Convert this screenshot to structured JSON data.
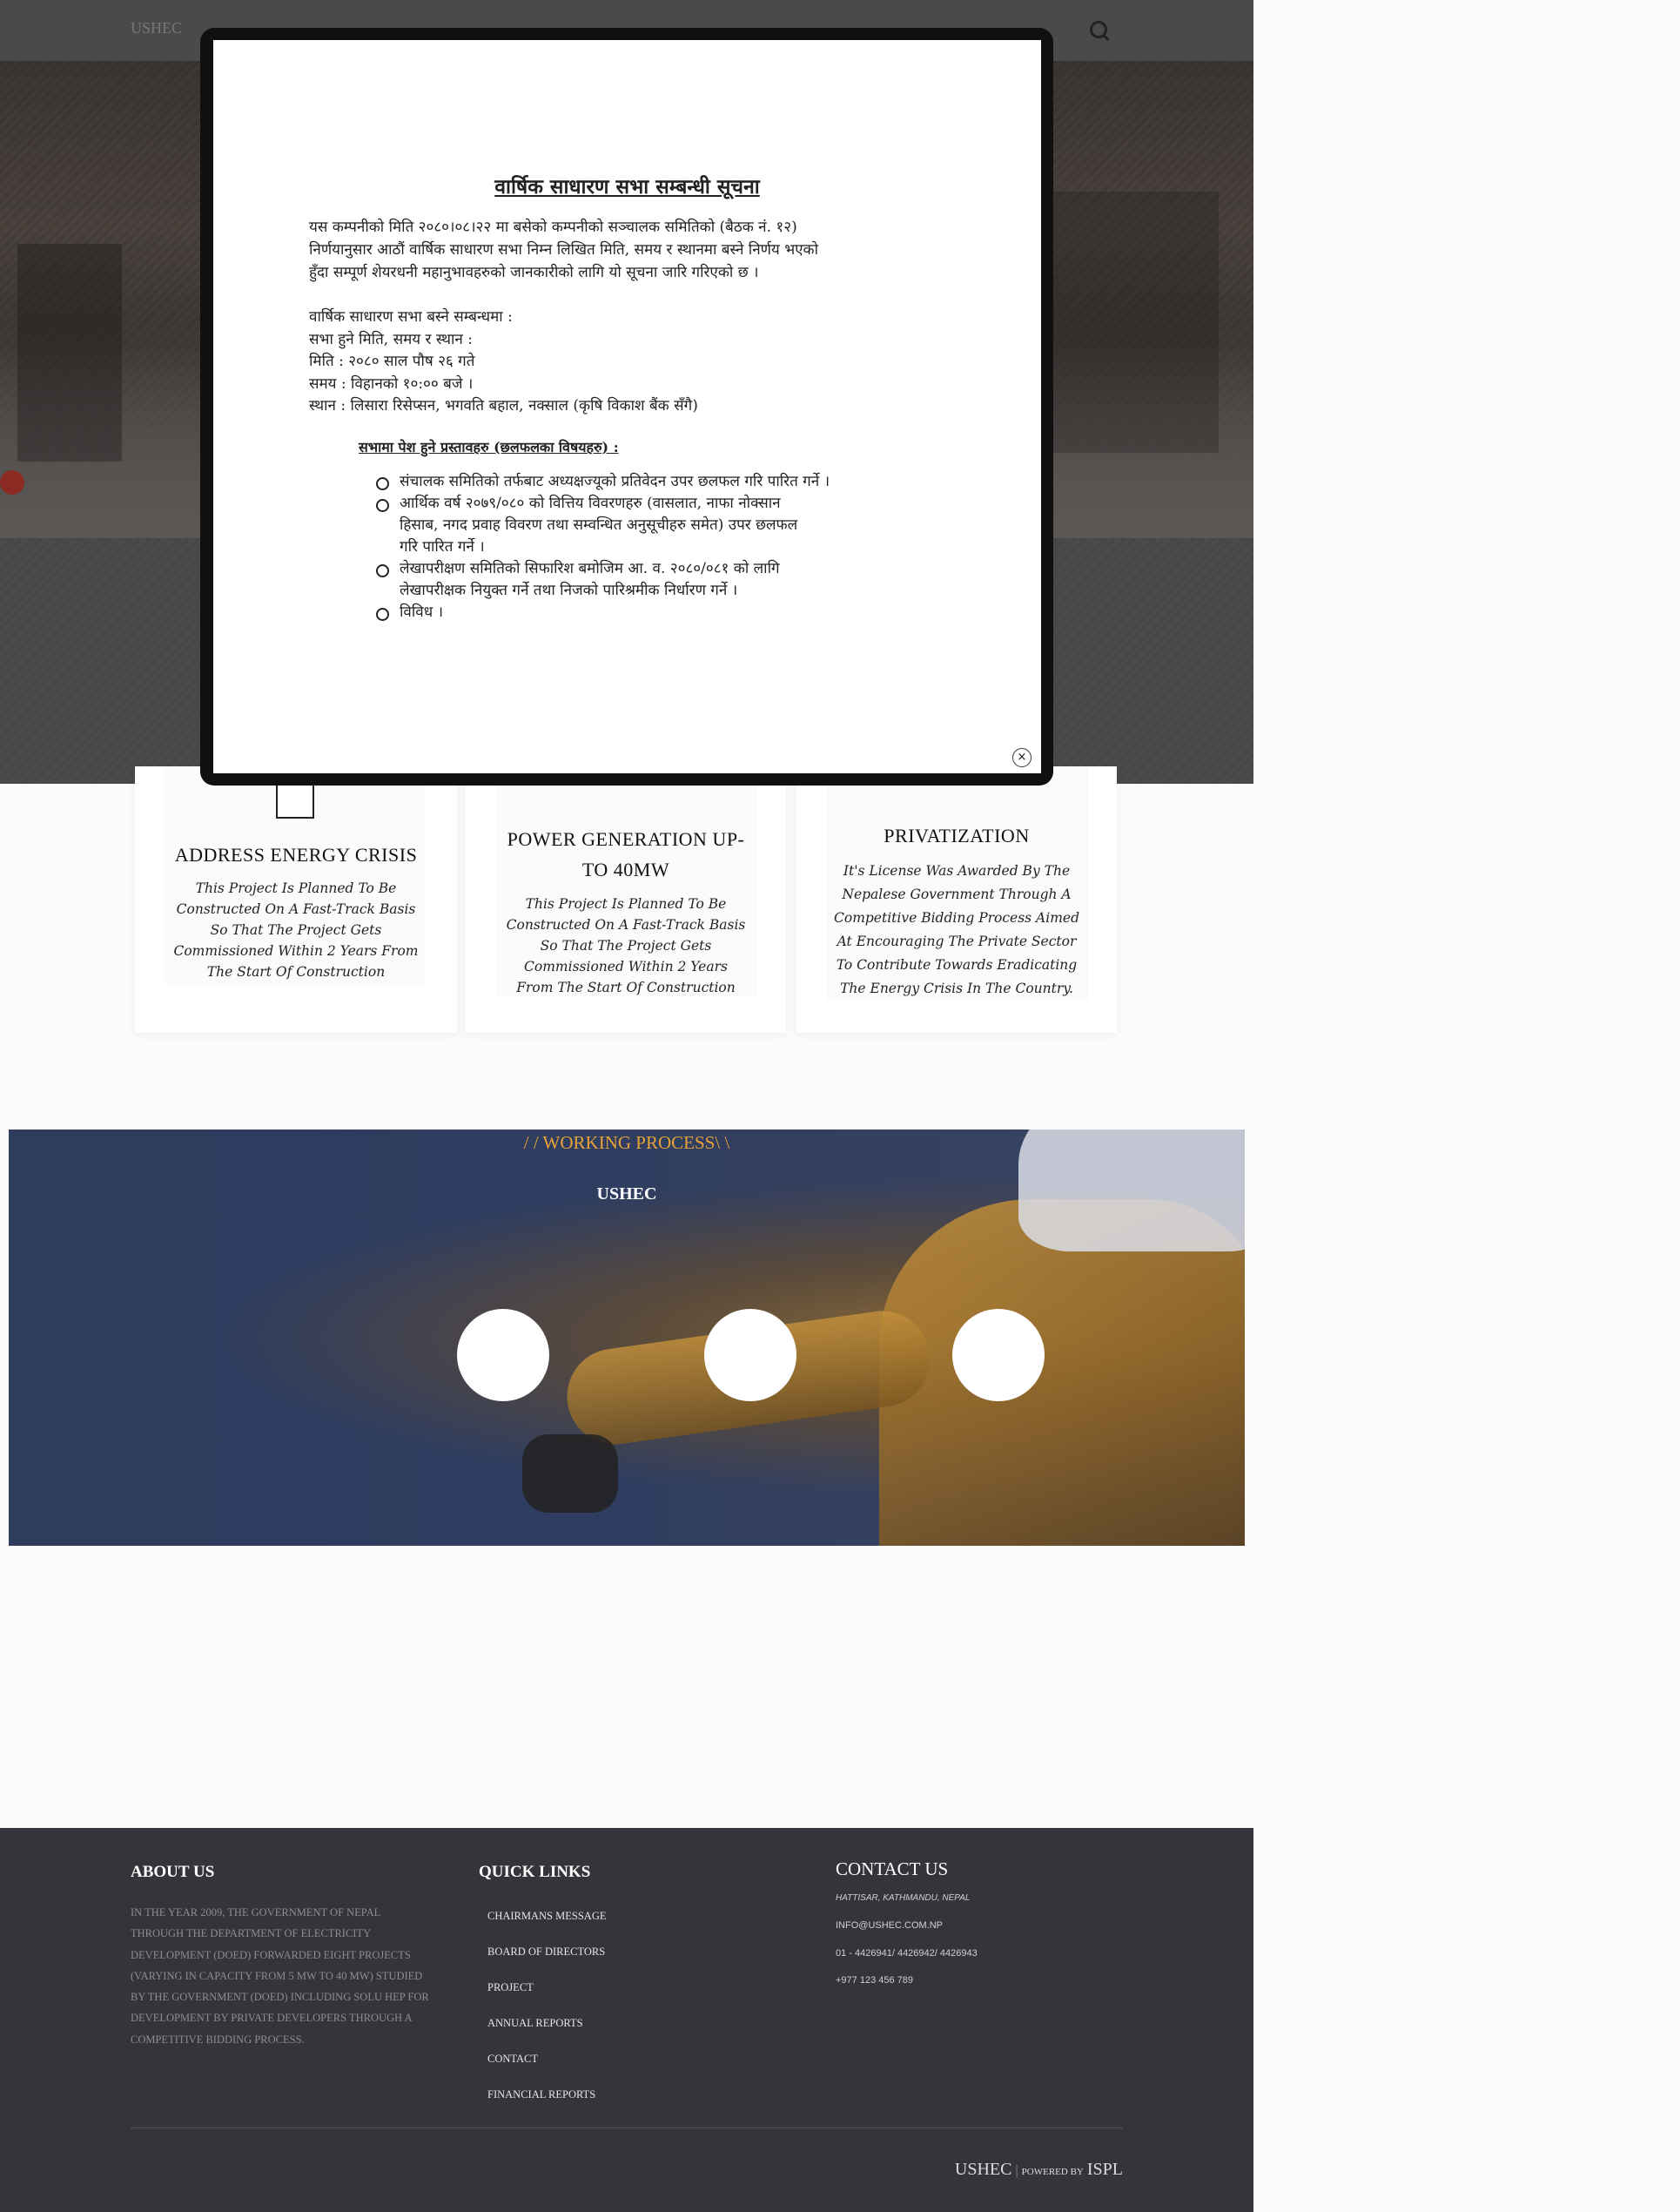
{
  "header": {
    "brand": "USHEC"
  },
  "features": [
    {
      "title": "ADDRESS ENERGY CRISIS",
      "text": "This Project Is Planned To Be Constructed On A Fast-Track Basis So That The Project Gets Commissioned Within 2 Years From The Start Of Construction"
    },
    {
      "title": "POWER GENERATION UP-TO 40MW",
      "text": "This Project Is Planned To Be Constructed On A Fast-Track Basis So That The Project Gets Commissioned Within 2 Years From The Start Of Construction"
    },
    {
      "title": "PRIVATIZATION",
      "text": "It's License Was Awarded By The Nepalese Government Through A Competitive Bidding Process Aimed At Encouraging The Private Sector To Contribute Towards Eradicating The Energy Crisis In The Country."
    }
  ],
  "process": {
    "title": "/ / WORKING PROCESS\\ \\",
    "subtitle": "USHEC"
  },
  "footer": {
    "about_heading": "ABOUT US",
    "about_text": "IN THE YEAR 2009,  THE GOVERNMENT OF NEPAL THROUGH THE DEPARTMENT OF ELECTRICITY DEVELOPMENT (DOED) FORWARDED EIGHT PROJECTS (VARYING IN CAPACITY FROM 5 MW TO 40 MW) STUDIED BY THE GOVERNMENT (DOED) INCLUDING SOLU HEP FOR DEVELOPMENT BY PRIVATE DEVELOPERS THROUGH A COMPETITIVE BIDDING PROCESS.",
    "links_heading": "QUICK LINKS",
    "links": [
      "CHAIRMANS MESSAGE",
      "BOARD OF DIRECTORS",
      "PROJECT",
      "ANNUAL REPORTS",
      "CONTACT",
      "FINANCIAL REPORTS"
    ],
    "contact_heading": "CONTACT US",
    "address": "HATTISAR, KATHMANDU, NEPAL",
    "email": "INFO@USHEC.COM.NP",
    "phone": "01 - 4426941/ 4426942/ 4426943",
    "mobile": "+977 123 456 789",
    "copyright_brand": "USHEC",
    "powered_by": "POWERED BY",
    "powered_brand": "ISPL"
  },
  "modal": {
    "notice_title": "वार्षिक साधारण सभा सम्बन्धी सूचना",
    "intro_lines": [
      "यस कम्पनीको मिति २०८०।०८।२२ मा बसेको कम्पनीको सञ्चालक समितिको (बैठक नं. १२)",
      "निर्णयानुसार आठौं वार्षिक साधारण सभा निम्न लिखित मिति, समय र स्थानमा बस्ने निर्णय भएको",
      "हुँदा सम्पूर्ण शेयरधनी महानुभावहरुको जानकारीको लागि यो सूचना जारि गरिएको छ ।"
    ],
    "meeting_lines": [
      "वार्षिक साधारण सभा बस्ने सम्बन्धमा :",
      "सभा हुने मिति, समय र स्थान :",
      "मिति : २०८० साल पौष २६ गते",
      "समय : विहानको १०:०० बजे ।",
      "स्थान : लिसारा रिसेप्सन, भगवति बहाल, नक्साल (कृषि विकाश बैंक सँगै)"
    ],
    "agenda_heading": "सभामा पेश हुने प्रस्तावहरु (छलफलका विषयहरु) :",
    "agenda": [
      [
        "संचालक समितिको तर्फबाट अध्यक्षज्यूको प्रतिवेदन उपर छलफल गरि पारित गर्ने ।"
      ],
      [
        "आर्थिक वर्ष २०७९/०८० को वित्तिय विवरणहरु (वासलात, नाफा नोक्सान",
        "हिसाब, नगद प्रवाह विवरण तथा सम्वन्धित अनुसूचीहरु समेत) उपर छलफल",
        "गरि पारित गर्ने ।"
      ],
      [
        "लेखापरीक्षण समितिको सिफारिश बमोजिम आ. व. २०८०/०८१ को लागि",
        "लेखापरीक्षक नियुक्त गर्ने तथा निजको पारिश्रमीक निर्धारण गर्ने ।"
      ],
      [
        "विविध ।"
      ]
    ],
    "close_label": "×"
  }
}
